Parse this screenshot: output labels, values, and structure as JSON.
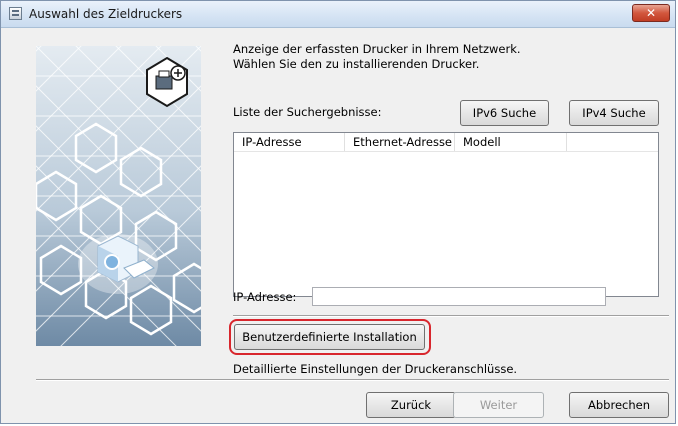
{
  "window": {
    "title": "Auswahl des Zieldruckers",
    "close_label": "✕"
  },
  "intro": {
    "line1": "Anzeige der erfassten Drucker in Ihrem Netzwerk.",
    "line2": "Wählen Sie den zu installierenden Drucker."
  },
  "search": {
    "list_label": "Liste der Suchergebnisse:",
    "ipv6_button": "IPv6 Suche",
    "ipv4_button": "IPv4 Suche"
  },
  "results_table": {
    "columns": [
      "IP-Adresse",
      "Ethernet-Adresse",
      "Modell",
      ""
    ],
    "rows": []
  },
  "ip_field": {
    "label": "IP-Adresse:",
    "value": ""
  },
  "custom_install": {
    "button_label": "Benutzerdefinierte Installation",
    "description": "Detaillierte Einstellungen der Druckeranschlüsse.",
    "highlight_color": "#d8262d"
  },
  "footer": {
    "back_button": "Zurück",
    "next_button": "Weiter",
    "cancel_button": "Abbrechen"
  },
  "icons": [
    "printer-app-icon",
    "hexagon-printer-icon",
    "printer-network-icon",
    "close-icon"
  ],
  "colors": {
    "panel_background": "#d9e3ec",
    "hexagon_stroke": "#ffffff",
    "accent_blue": "#1e86c8"
  }
}
